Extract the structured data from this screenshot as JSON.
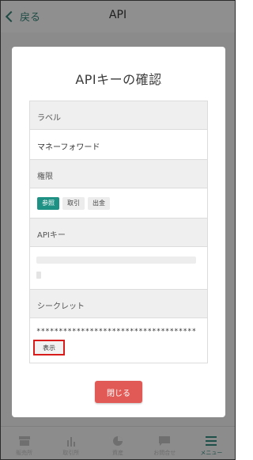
{
  "header": {
    "back_label": "戻る",
    "title": "API"
  },
  "modal": {
    "title": "APIキーの確認",
    "label_header": "ラベル",
    "label_value": "マネーフォワード",
    "perm_header": "権限",
    "permissions": [
      "参照",
      "取引",
      "出金"
    ],
    "apikey_header": "APIキー",
    "secret_header": "シークレット",
    "secret_value": "************************************",
    "show_label": "表示",
    "close_label": "閉じる"
  },
  "tabbar": {
    "items": [
      {
        "label": "販売所",
        "icon": "shop-icon"
      },
      {
        "label": "取引所",
        "icon": "bar-chart-icon"
      },
      {
        "label": "資産",
        "icon": "pie-chart-icon"
      },
      {
        "label": "お問合せ",
        "icon": "chat-icon"
      },
      {
        "label": "メニュー",
        "icon": "menu-icon"
      }
    ]
  },
  "colors": {
    "accent": "#1f9184",
    "close": "#e25a55",
    "highlight": "#d81b1b"
  }
}
